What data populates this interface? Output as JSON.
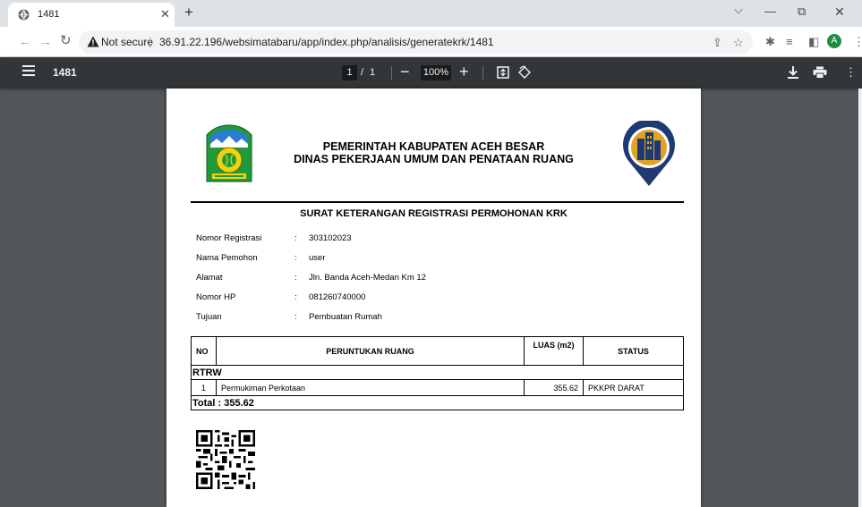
{
  "browser": {
    "tab_title": "1481",
    "security_label": "Not secure",
    "url": "36.91.22.196/websimatabaru/app/index.php/analisis/generatekrk/1481",
    "avatar_initial": "A"
  },
  "viewer": {
    "title": "1481",
    "current_page": "1",
    "page_separator": "/",
    "total_pages": "1",
    "zoom": "100%"
  },
  "document": {
    "org_line1": "PEMERINTAH KABUPATEN ACEH BESAR",
    "org_line2": "DINAS PEKERJAAN UMUM DAN PENATAAN RUANG",
    "title": "SURAT KETERANGAN REGISTRASI PERMOHONAN KRK",
    "fields": [
      {
        "label": "Nomor Registrasi",
        "value": "303102023"
      },
      {
        "label": "Nama Pemohon",
        "value": "user"
      },
      {
        "label": "Alamat",
        "value": "Jln. Banda Aceh-Medan Km 12"
      },
      {
        "label": "Nomor HP",
        "value": "081260740000"
      },
      {
        "label": "Tujuan",
        "value": "Pembuatan Rumah"
      }
    ],
    "table": {
      "headers": {
        "no": "NO",
        "peruntukan": "PERUNTUKAN RUANG",
        "luas": "LUAS (m2)",
        "status": "STATUS"
      },
      "group": "RTRW",
      "rows": [
        {
          "no": "1",
          "peruntukan": "Permukiman Perkotaan",
          "luas": "355.62",
          "status": "PKKPR DARAT"
        }
      ],
      "total": "Total : 355.62"
    }
  },
  "colors": {
    "viewer_bg": "#525659",
    "viewer_toolbar": "#323639",
    "logo_green": "#1f9b3b",
    "logo_yellow": "#f2d20f",
    "pin_navy": "#1f3a73",
    "pin_gold": "#e0a325"
  }
}
